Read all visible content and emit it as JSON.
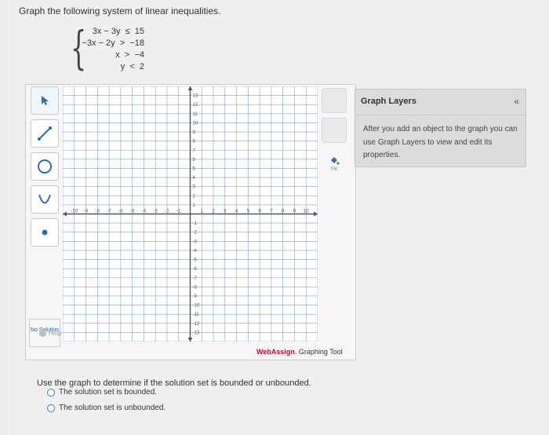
{
  "prompt": "Graph the following system of linear inequalities.",
  "system": [
    {
      "text": "3x − 3y  ≤  15"
    },
    {
      "text": "−3x − 2y  >  −18"
    },
    {
      "text": "x  >  −4"
    },
    {
      "text": "y  <  2"
    }
  ],
  "toolbar": {
    "tools": [
      "pointer",
      "line",
      "circle",
      "parabola",
      "point"
    ],
    "no_solution": "No Solution",
    "help": "Help"
  },
  "graph": {
    "x_ticks": [
      "-10",
      "-9",
      "-8",
      "-7",
      "-6",
      "-5",
      "-4",
      "-3",
      "-2",
      "-1",
      "1",
      "2",
      "3",
      "4",
      "5",
      "6",
      "7",
      "8",
      "9",
      "10"
    ],
    "y_ticks_pos": [
      "13",
      "12",
      "11",
      "10",
      "9",
      "8",
      "7",
      "6",
      "5",
      "4",
      "3",
      "2",
      "1"
    ],
    "y_ticks_neg": [
      "-1",
      "-2",
      "-3",
      "-4",
      "-5",
      "-6",
      "-7",
      "-8",
      "-9",
      "-10",
      "-11",
      "-12",
      "-13"
    ],
    "fill_label": "Fill"
  },
  "branding": {
    "brand": "WebAssign",
    "suffix": ". Graphing Tool"
  },
  "layers": {
    "title": "Graph Layers",
    "collapse": "«",
    "body": "After you add an object to the graph you can use Graph Layers to view and edit its properties."
  },
  "question": {
    "text": "Use the graph to determine if the solution set is bounded or unbounded.",
    "options": [
      "The solution set is bounded.",
      "The solution set is unbounded."
    ]
  },
  "colors": {
    "grid": "#7fa3c9",
    "axis": "#555555",
    "brand": "#c8102e",
    "radio": "#3c7ac8"
  }
}
